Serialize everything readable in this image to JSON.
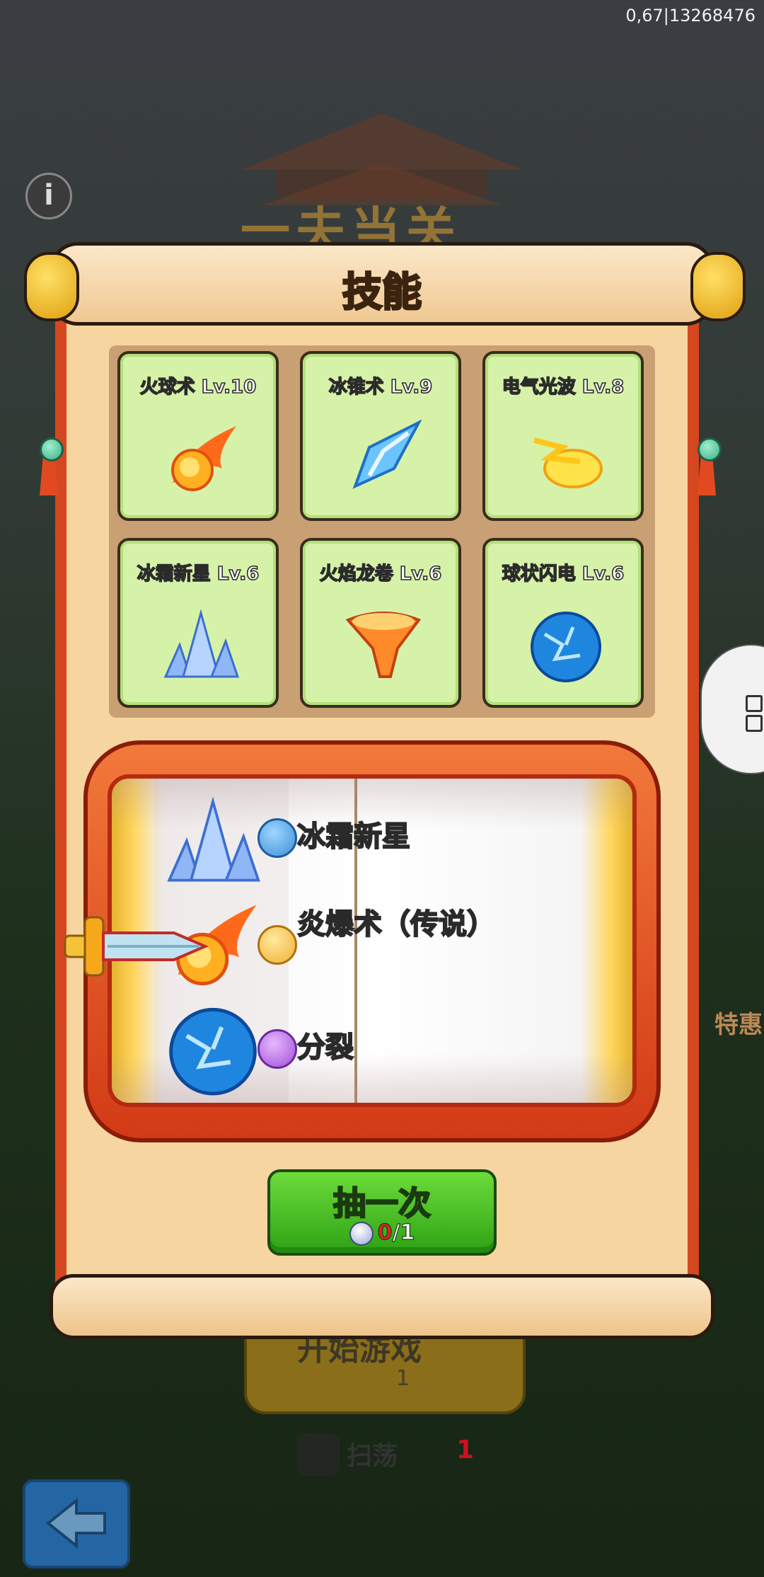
{
  "status": {
    "build_id": "0,67|13268476"
  },
  "background": {
    "game_title": "一夫当关",
    "promo_text": "特惠",
    "start_label": "开始游戏",
    "start_cost": "1",
    "sweep_label": "扫荡",
    "sweep_cost": "1"
  },
  "panel": {
    "title": "技能",
    "skills": [
      {
        "label": "火球术 Lv.10",
        "icon": "fireball-icon"
      },
      {
        "label": "冰锥术 Lv.9",
        "icon": "ice-shard-icon"
      },
      {
        "label": "电气光波 Lv.8",
        "icon": "electric-wave-icon"
      },
      {
        "label": "冰霜新星 Lv.6",
        "icon": "frost-nova-icon"
      },
      {
        "label": "火焰龙卷 Lv.6",
        "icon": "fire-tornado-icon"
      },
      {
        "label": "球状闪电 Lv.6",
        "icon": "ball-lightning-icon"
      }
    ],
    "slot_results": [
      {
        "label": "冰霜新星",
        "rarity": "blue",
        "icon": "frost-nova-icon"
      },
      {
        "label": "炎爆术（传说）",
        "rarity": "gold",
        "icon": "fireball-icon"
      },
      {
        "label": "分裂",
        "rarity": "purple",
        "icon": "ball-lightning-icon"
      }
    ],
    "draw_button": {
      "label": "抽一次",
      "have": "0",
      "total": "/1"
    }
  },
  "colors": {
    "rarity_blue": "#3a8fd8",
    "rarity_gold": "#f0b030",
    "rarity_purple": "#a24ed8",
    "accent_green": "#3cb31e"
  }
}
